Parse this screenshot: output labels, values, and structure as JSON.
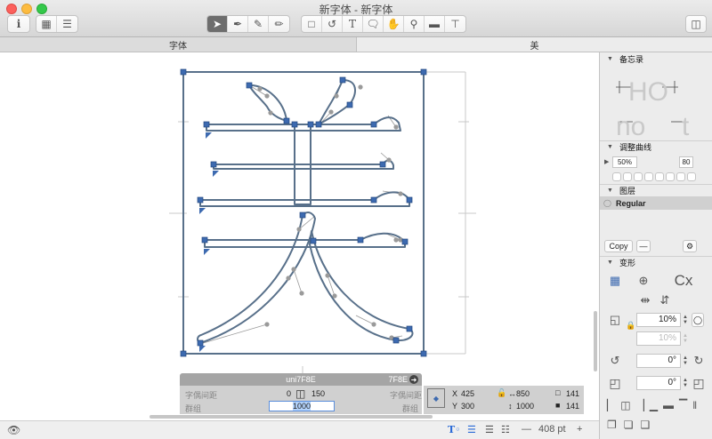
{
  "window": {
    "title": "新字体 - 新字体"
  },
  "tabs": [
    {
      "label": "字体"
    },
    {
      "label": "美"
    }
  ],
  "toolbar": {
    "info_label": "i",
    "text_tool_label": "T"
  },
  "info_box": {
    "glyph_name": "uni7F8E",
    "unicode": "7F8E",
    "lsb_label": "字偶间距",
    "lsb_value": "0",
    "width_value": "150",
    "rsb_label": "字偶间距",
    "group_label": "群组",
    "group_label_right": "群组",
    "name_field_value": "1000"
  },
  "coords": {
    "x_label": "X",
    "x": "425",
    "y_label": "Y",
    "y": "300",
    "w": "850",
    "h": "1000",
    "count1": "141",
    "count2": "141"
  },
  "bottom": {
    "zoom": "408 pt",
    "minus": "—",
    "plus": "+"
  },
  "panel": {
    "notes_title": "备忘录",
    "curve_title": "调整曲线",
    "curve_pct": "50%",
    "curve_val": "80",
    "layers_title": "图层",
    "layer_name": "Regular",
    "copy_label": "Copy",
    "transform_title": "变形",
    "scale_pct": "10%",
    "scale_pct2": "10%",
    "rotate": "0°",
    "slant": "0°",
    "cx_label": "Cx"
  },
  "preview_text": {
    "line1": "HO",
    "line2a": "no",
    "line2b": "t"
  }
}
